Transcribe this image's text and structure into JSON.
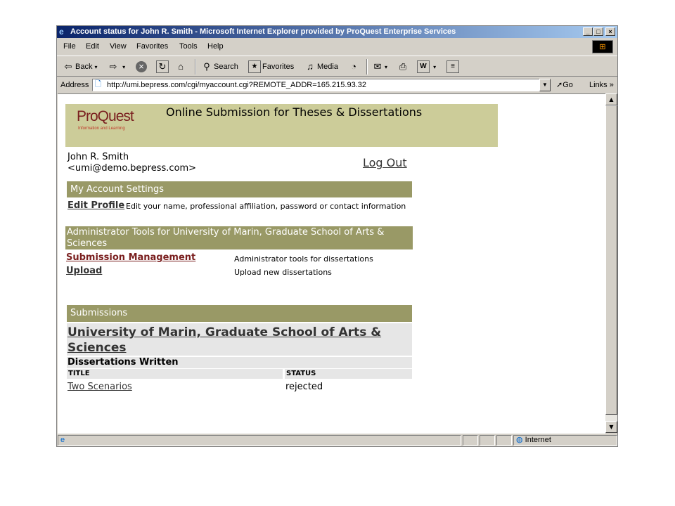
{
  "window": {
    "title": "Account status for John R. Smith - Microsoft Internet Explorer provided by ProQuest Enterprise Services"
  },
  "menu": [
    "File",
    "Edit",
    "View",
    "Favorites",
    "Tools",
    "Help"
  ],
  "toolbar": {
    "back": "Back",
    "search": "Search",
    "favorites": "Favorites",
    "media": "Media"
  },
  "address": {
    "label": "Address",
    "url": "http://umi.bepress.com/cgi/myaccount.cgi?REMOTE_ADDR=165.215.93.32",
    "go": "Go",
    "links": "Links"
  },
  "status": {
    "zone": "Internet"
  },
  "page": {
    "logo_text": "ProQuest",
    "logo_sub": "Information and Learning",
    "header_title": "Online Submission for Theses & Dissertations",
    "user_name": "John R. Smith",
    "user_email": "<umi@demo.bepress.com>",
    "logout": "Log Out",
    "account_settings_heading": "My Account Settings",
    "edit_profile_link": "Edit Profile",
    "edit_profile_desc": "Edit your name, professional affiliation, password or contact information",
    "admin_heading": "Administrator Tools for University of Marin, Graduate School of Arts & Sciences",
    "admin_tools": [
      {
        "label": "Submission Management",
        "desc": "Administrator tools for dissertations"
      },
      {
        "label": "Upload",
        "desc": "Upload new dissertations"
      }
    ],
    "submissions_heading": "Submissions",
    "institution_link": "University of Marin, Graduate School of Arts & Sciences",
    "dissertations_heading": "Dissertations Written",
    "table": {
      "headers": [
        "TITLE",
        "STATUS"
      ],
      "rows": [
        {
          "title": "Two Scenarios",
          "status": "rejected"
        }
      ]
    }
  }
}
